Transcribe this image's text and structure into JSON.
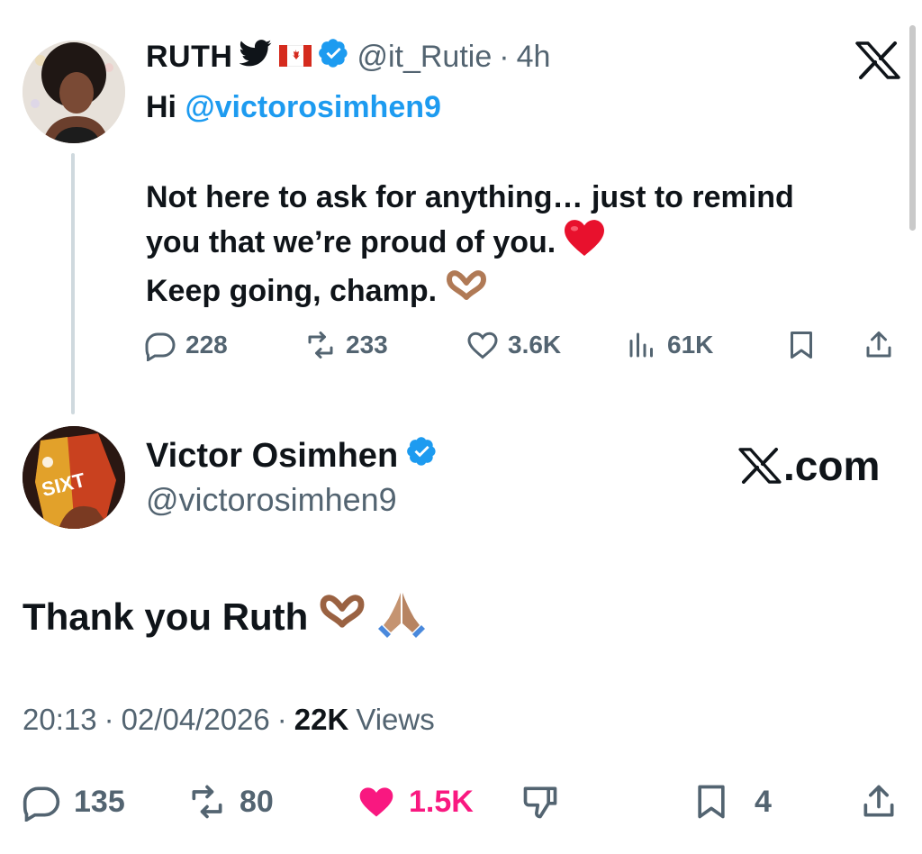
{
  "parent_tweet": {
    "author_name": "RUTH",
    "handle": "@it_Rutie",
    "dot": "·",
    "time": "4h",
    "mention": "@victorosimhen9",
    "greeting": "Hi",
    "lines": [
      "Not here to ask for anything… just to remind",
      "you that we’re proud of you.",
      "Keep going, champ."
    ],
    "stats": {
      "replies": "228",
      "reposts": "233",
      "likes": "3.6K",
      "views": "61K"
    }
  },
  "reply_tweet": {
    "author_name": "Victor Osimhen",
    "handle": "@victorosimhen9",
    "watermark_suffix": ".com",
    "text": "Thank you Ruth",
    "time": "20:13",
    "date": "02/04/2026",
    "dot": "·",
    "views_count": "22K",
    "views_label": "Views",
    "stats": {
      "replies": "135",
      "reposts": "80",
      "likes": "1.5K",
      "bookmarks": "4"
    },
    "avatar_logo_text": "SIXT"
  },
  "colors": {
    "accent": "#1d9bf0",
    "secondary_text": "#536471",
    "like_pink": "#f91880",
    "thread_line": "#cfd9de"
  },
  "icons": [
    "twitter-bird-icon",
    "canada-flag-icon",
    "verified-badge-icon",
    "x-logo-icon",
    "red-heart-emoji",
    "heart-hands-emoji",
    "folded-hands-emoji",
    "reply-icon",
    "repost-icon",
    "like-icon",
    "views-icon",
    "bookmark-icon",
    "share-icon",
    "dislike-icon"
  ]
}
